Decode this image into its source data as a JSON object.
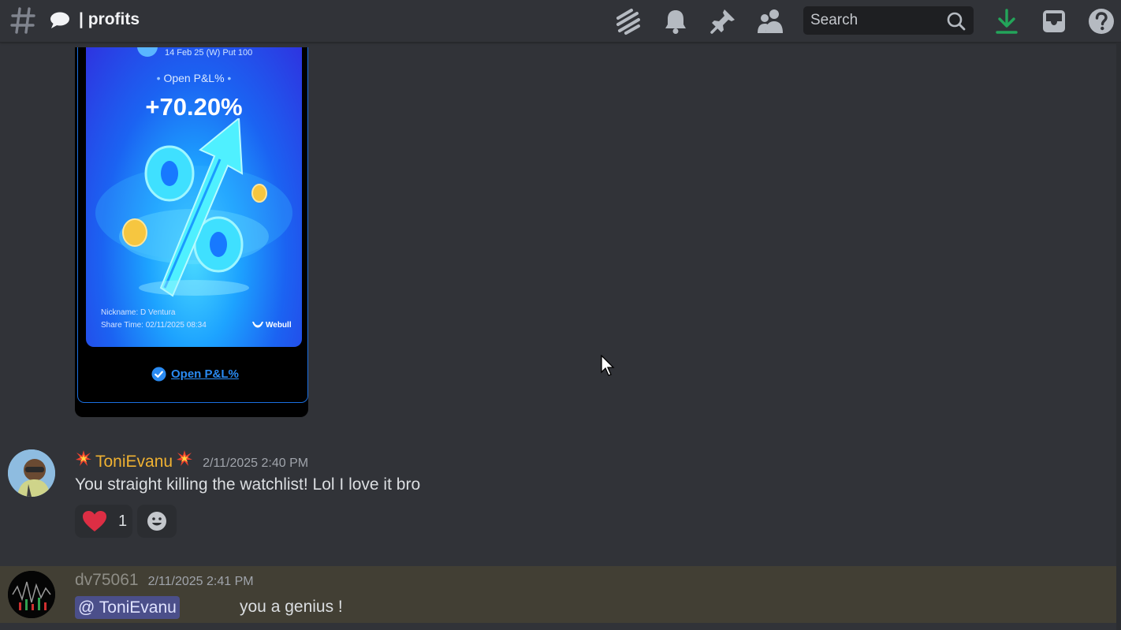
{
  "header": {
    "channel_name": "| profits",
    "search_placeholder": "Search",
    "colors": {
      "download_icon": "#23a55a",
      "icons": "#b5bac1"
    }
  },
  "embed": {
    "contract": "14 Feb 25 (W) Put 100",
    "pl_title": "Open P&L%",
    "pl_value": "+70.20%",
    "nickname": "Nickname: D Ventura",
    "share_time": "Share Time: 02/11/2025 08:34",
    "brand": "Webull",
    "link_label": "Open P&L%"
  },
  "messages": [
    {
      "username": "ToniEvanu",
      "username_color": "#f0b232",
      "timestamp": "2/11/2025 2:40 PM",
      "text": "You straight killing the watchlist! Lol I love it bro",
      "reaction": {
        "emoji": "heart-icon",
        "count": "1"
      }
    },
    {
      "username": "dv75061",
      "username_color": "#8e8d86",
      "timestamp": "2/11/2025 2:41 PM",
      "mention": "@ ToniEvanu",
      "text": "you a genius !"
    }
  ]
}
